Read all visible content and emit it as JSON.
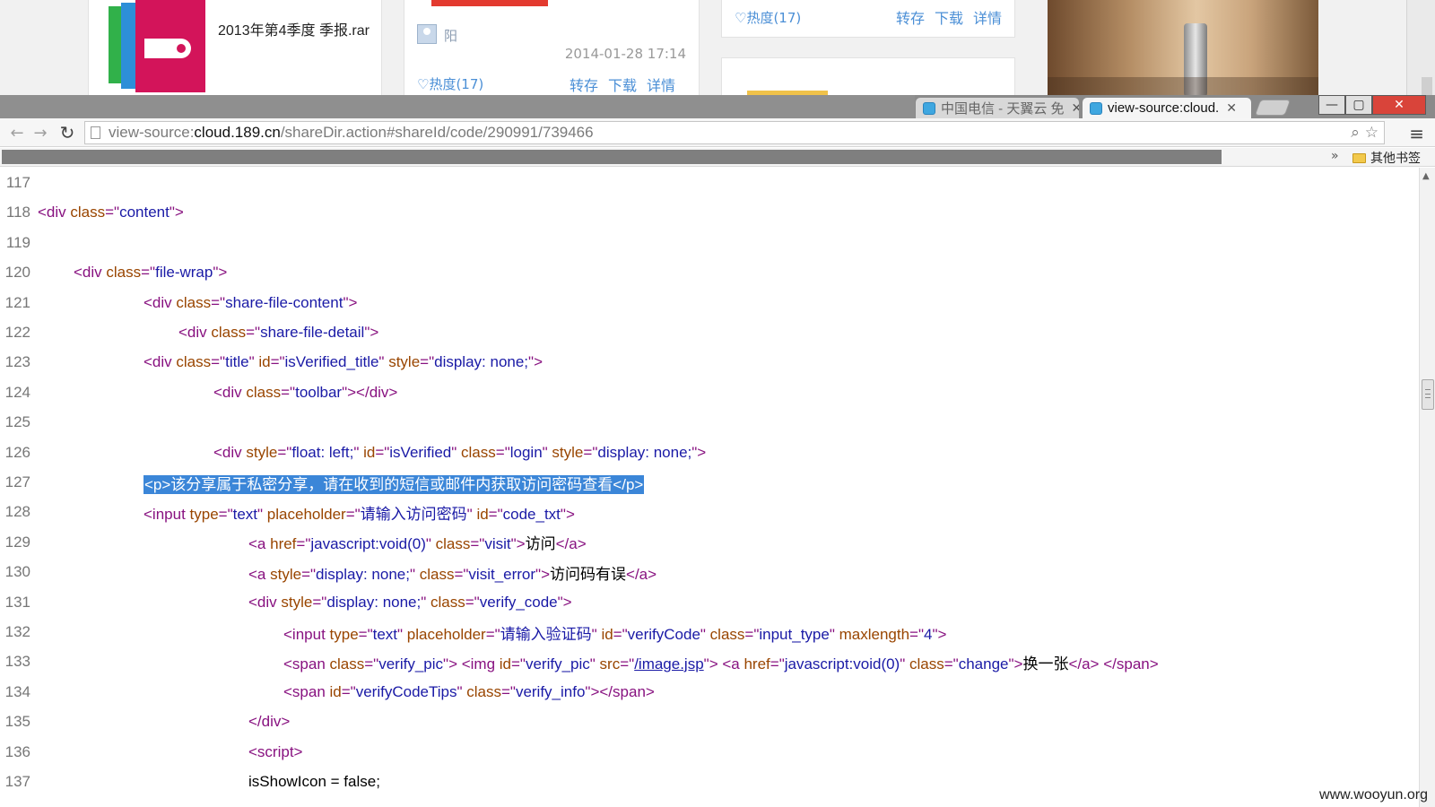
{
  "background_page": {
    "file_card": {
      "filename": "2013年第4季度 季报.rar"
    },
    "share_card": {
      "user_name": "阳",
      "datetime": "2014-01-28 17:14",
      "heat": "♡热度(17)",
      "actions": [
        "转存",
        "下载",
        "详情"
      ]
    },
    "top_card": {
      "heat": "♡热度(17)",
      "actions": [
        "转存",
        "下载",
        "详情"
      ]
    }
  },
  "browser": {
    "tabs": [
      {
        "title": "中国电信 - 天翼云 免",
        "active": false
      },
      {
        "title": "view-source:cloud.",
        "active": true
      }
    ],
    "window_buttons": {
      "minimize": "—",
      "maximize": "▢",
      "close": "✕"
    },
    "address_bar": {
      "scheme": "view-source:",
      "host": "cloud.189.cn",
      "path": "/shareDir.action#shareId/code/290991/739466"
    },
    "bookmarks": {
      "chevron": "»",
      "other_bookmarks": "其他书签"
    },
    "icons": {
      "back": "arrow-left-icon",
      "forward": "arrow-right-icon",
      "reload": "reload-icon",
      "search": "search-icon",
      "star": "star-icon",
      "menu": "menu-icon"
    }
  },
  "source_lines": [
    {
      "n": "117",
      "indent": 0,
      "segs": []
    },
    {
      "n": "118",
      "indent": 0,
      "segs": [
        [
          "tg",
          "<div "
        ],
        [
          "an",
          "class"
        ],
        [
          "tg",
          "=\""
        ],
        [
          "av",
          "content"
        ],
        [
          "tg",
          "\">"
        ]
      ]
    },
    {
      "n": "119",
      "indent": 0,
      "segs": []
    },
    {
      "n": "120",
      "indent": 40,
      "segs": [
        [
          "tg",
          "<div "
        ],
        [
          "an",
          "class"
        ],
        [
          "tg",
          "=\""
        ],
        [
          "av",
          "file-wrap"
        ],
        [
          "tg",
          "\">"
        ]
      ]
    },
    {
      "n": "121",
      "indent": 118,
      "segs": [
        [
          "tg",
          "<div "
        ],
        [
          "an",
          "class"
        ],
        [
          "tg",
          "=\""
        ],
        [
          "av",
          "share-file-content"
        ],
        [
          "tg",
          "\">"
        ]
      ]
    },
    {
      "n": "122",
      "indent": 157,
      "segs": [
        [
          "tg",
          "<div "
        ],
        [
          "an",
          "class"
        ],
        [
          "tg",
          "=\""
        ],
        [
          "av",
          "share-file-detail"
        ],
        [
          "tg",
          "\">"
        ]
      ]
    },
    {
      "n": "123",
      "indent": 118,
      "segs": [
        [
          "tg",
          "<div "
        ],
        [
          "an",
          "class"
        ],
        [
          "tg",
          "=\""
        ],
        [
          "av",
          "title"
        ],
        [
          "tg",
          "\" "
        ],
        [
          "an",
          "id"
        ],
        [
          "tg",
          "=\""
        ],
        [
          "av",
          "isVerified_title"
        ],
        [
          "tg",
          "\" "
        ],
        [
          "an",
          "style"
        ],
        [
          "tg",
          "=\""
        ],
        [
          "av",
          "display: none;"
        ],
        [
          "tg",
          "\">"
        ]
      ]
    },
    {
      "n": "124",
      "indent": 196,
      "segs": [
        [
          "tg",
          "<div "
        ],
        [
          "an",
          "class"
        ],
        [
          "tg",
          "=\""
        ],
        [
          "av",
          "toolbar"
        ],
        [
          "tg",
          "\"></div>"
        ]
      ]
    },
    {
      "n": "125",
      "indent": 0,
      "segs": []
    },
    {
      "n": "126",
      "indent": 196,
      "segs": [
        [
          "tg",
          "<div "
        ],
        [
          "an",
          "style"
        ],
        [
          "tg",
          "=\""
        ],
        [
          "av",
          "float: left;"
        ],
        [
          "tg",
          "\" "
        ],
        [
          "an",
          "id"
        ],
        [
          "tg",
          "=\""
        ],
        [
          "av",
          "isVerified"
        ],
        [
          "tg",
          "\" "
        ],
        [
          "an",
          "class"
        ],
        [
          "tg",
          "=\""
        ],
        [
          "av",
          "login"
        ],
        [
          "tg",
          "\" "
        ],
        [
          "an",
          "style"
        ],
        [
          "tg",
          "=\""
        ],
        [
          "av",
          "display: none;"
        ],
        [
          "tg",
          "\">"
        ]
      ]
    },
    {
      "n": "127",
      "indent": 118,
      "segs": [
        [
          "hl",
          "<p>该分享属于私密分享，请在收到的短信或邮件内获取访问密码查看</p>"
        ]
      ]
    },
    {
      "n": "128",
      "indent": 118,
      "segs": [
        [
          "tg",
          "<input "
        ],
        [
          "an",
          "type"
        ],
        [
          "tg",
          "=\""
        ],
        [
          "av",
          "text"
        ],
        [
          "tg",
          "\" "
        ],
        [
          "an",
          "placeholder"
        ],
        [
          "tg",
          "=\""
        ],
        [
          "av",
          "请输入访问密码"
        ],
        [
          "tg",
          "\" "
        ],
        [
          "an",
          "id"
        ],
        [
          "tg",
          "=\""
        ],
        [
          "av",
          "code_txt"
        ],
        [
          "tg",
          "\">"
        ]
      ]
    },
    {
      "n": "129",
      "indent": 235,
      "segs": [
        [
          "tg",
          "<a "
        ],
        [
          "an",
          "href"
        ],
        [
          "tg",
          "=\""
        ],
        [
          "av",
          "javascript:void(0)"
        ],
        [
          "tg",
          "\" "
        ],
        [
          "an",
          "class"
        ],
        [
          "tg",
          "=\""
        ],
        [
          "av",
          "visit"
        ],
        [
          "tg",
          "\">"
        ],
        [
          "tx",
          "访问"
        ],
        [
          "tg",
          "</a>"
        ]
      ]
    },
    {
      "n": "130",
      "indent": 235,
      "segs": [
        [
          "tg",
          "<a "
        ],
        [
          "an",
          "style"
        ],
        [
          "tg",
          "=\""
        ],
        [
          "av",
          "display: none;"
        ],
        [
          "tg",
          "\" "
        ],
        [
          "an",
          "class"
        ],
        [
          "tg",
          "=\""
        ],
        [
          "av",
          "visit_error"
        ],
        [
          "tg",
          "\">"
        ],
        [
          "tx",
          "访问码有误"
        ],
        [
          "tg",
          "</a>"
        ]
      ]
    },
    {
      "n": "131",
      "indent": 235,
      "segs": [
        [
          "tg",
          "<div "
        ],
        [
          "an",
          "style"
        ],
        [
          "tg",
          "=\""
        ],
        [
          "av",
          "display: none;"
        ],
        [
          "tg",
          "\" "
        ],
        [
          "an",
          "class"
        ],
        [
          "tg",
          "=\""
        ],
        [
          "av",
          "verify_code"
        ],
        [
          "tg",
          "\">"
        ]
      ]
    },
    {
      "n": "132",
      "indent": 274,
      "segs": [
        [
          "tg",
          "<input "
        ],
        [
          "an",
          "type"
        ],
        [
          "tg",
          "=\""
        ],
        [
          "av",
          "text"
        ],
        [
          "tg",
          "\" "
        ],
        [
          "an",
          "placeholder"
        ],
        [
          "tg",
          "=\""
        ],
        [
          "av",
          "请输入验证码"
        ],
        [
          "tg",
          "\" "
        ],
        [
          "an",
          "id"
        ],
        [
          "tg",
          "=\""
        ],
        [
          "av",
          "verifyCode"
        ],
        [
          "tg",
          "\" "
        ],
        [
          "an",
          "class"
        ],
        [
          "tg",
          "=\""
        ],
        [
          "av",
          "input_type"
        ],
        [
          "tg",
          "\" "
        ],
        [
          "an",
          "maxlength"
        ],
        [
          "tg",
          "=\""
        ],
        [
          "av",
          "4"
        ],
        [
          "tg",
          "\">"
        ]
      ]
    },
    {
      "n": "133",
      "indent": 274,
      "segs": [
        [
          "tg",
          "<span "
        ],
        [
          "an",
          "class"
        ],
        [
          "tg",
          "=\""
        ],
        [
          "av",
          "verify_pic"
        ],
        [
          "tg",
          "\"> <img "
        ],
        [
          "an",
          "id"
        ],
        [
          "tg",
          "=\""
        ],
        [
          "av",
          "verify_pic"
        ],
        [
          "tg",
          "\" "
        ],
        [
          "an",
          "src"
        ],
        [
          "tg",
          "=\""
        ],
        [
          "lnk",
          "/image.jsp"
        ],
        [
          "tg",
          "\"> <a "
        ],
        [
          "an",
          "href"
        ],
        [
          "tg",
          "=\""
        ],
        [
          "av",
          "javascript:void(0)"
        ],
        [
          "tg",
          "\" "
        ],
        [
          "an",
          "class"
        ],
        [
          "tg",
          "=\""
        ],
        [
          "av",
          "change"
        ],
        [
          "tg",
          "\">"
        ],
        [
          "tx",
          "换一张"
        ],
        [
          "tg",
          "</a> </span>"
        ]
      ]
    },
    {
      "n": "134",
      "indent": 274,
      "segs": [
        [
          "tg",
          "<span "
        ],
        [
          "an",
          "id"
        ],
        [
          "tg",
          "=\""
        ],
        [
          "av",
          "verifyCodeTips"
        ],
        [
          "tg",
          "\" "
        ],
        [
          "an",
          "class"
        ],
        [
          "tg",
          "=\""
        ],
        [
          "av",
          "verify_info"
        ],
        [
          "tg",
          "\"></span>"
        ]
      ]
    },
    {
      "n": "135",
      "indent": 235,
      "segs": [
        [
          "tg",
          "</div>"
        ]
      ]
    },
    {
      "n": "136",
      "indent": 235,
      "segs": [
        [
          "tg",
          "<script>"
        ]
      ]
    },
    {
      "n": "137",
      "indent": 235,
      "segs": [
        [
          "tx",
          "isShowIcon = false;"
        ]
      ]
    }
  ],
  "watermark": "www.wooyun.org",
  "colors": {
    "tag": "#881280",
    "attr_name": "#994500",
    "attr_value": "#1a1aa6",
    "selection": "#3b86d8",
    "close_button": "#d9443a",
    "link_blue": "#4b8fd6"
  }
}
